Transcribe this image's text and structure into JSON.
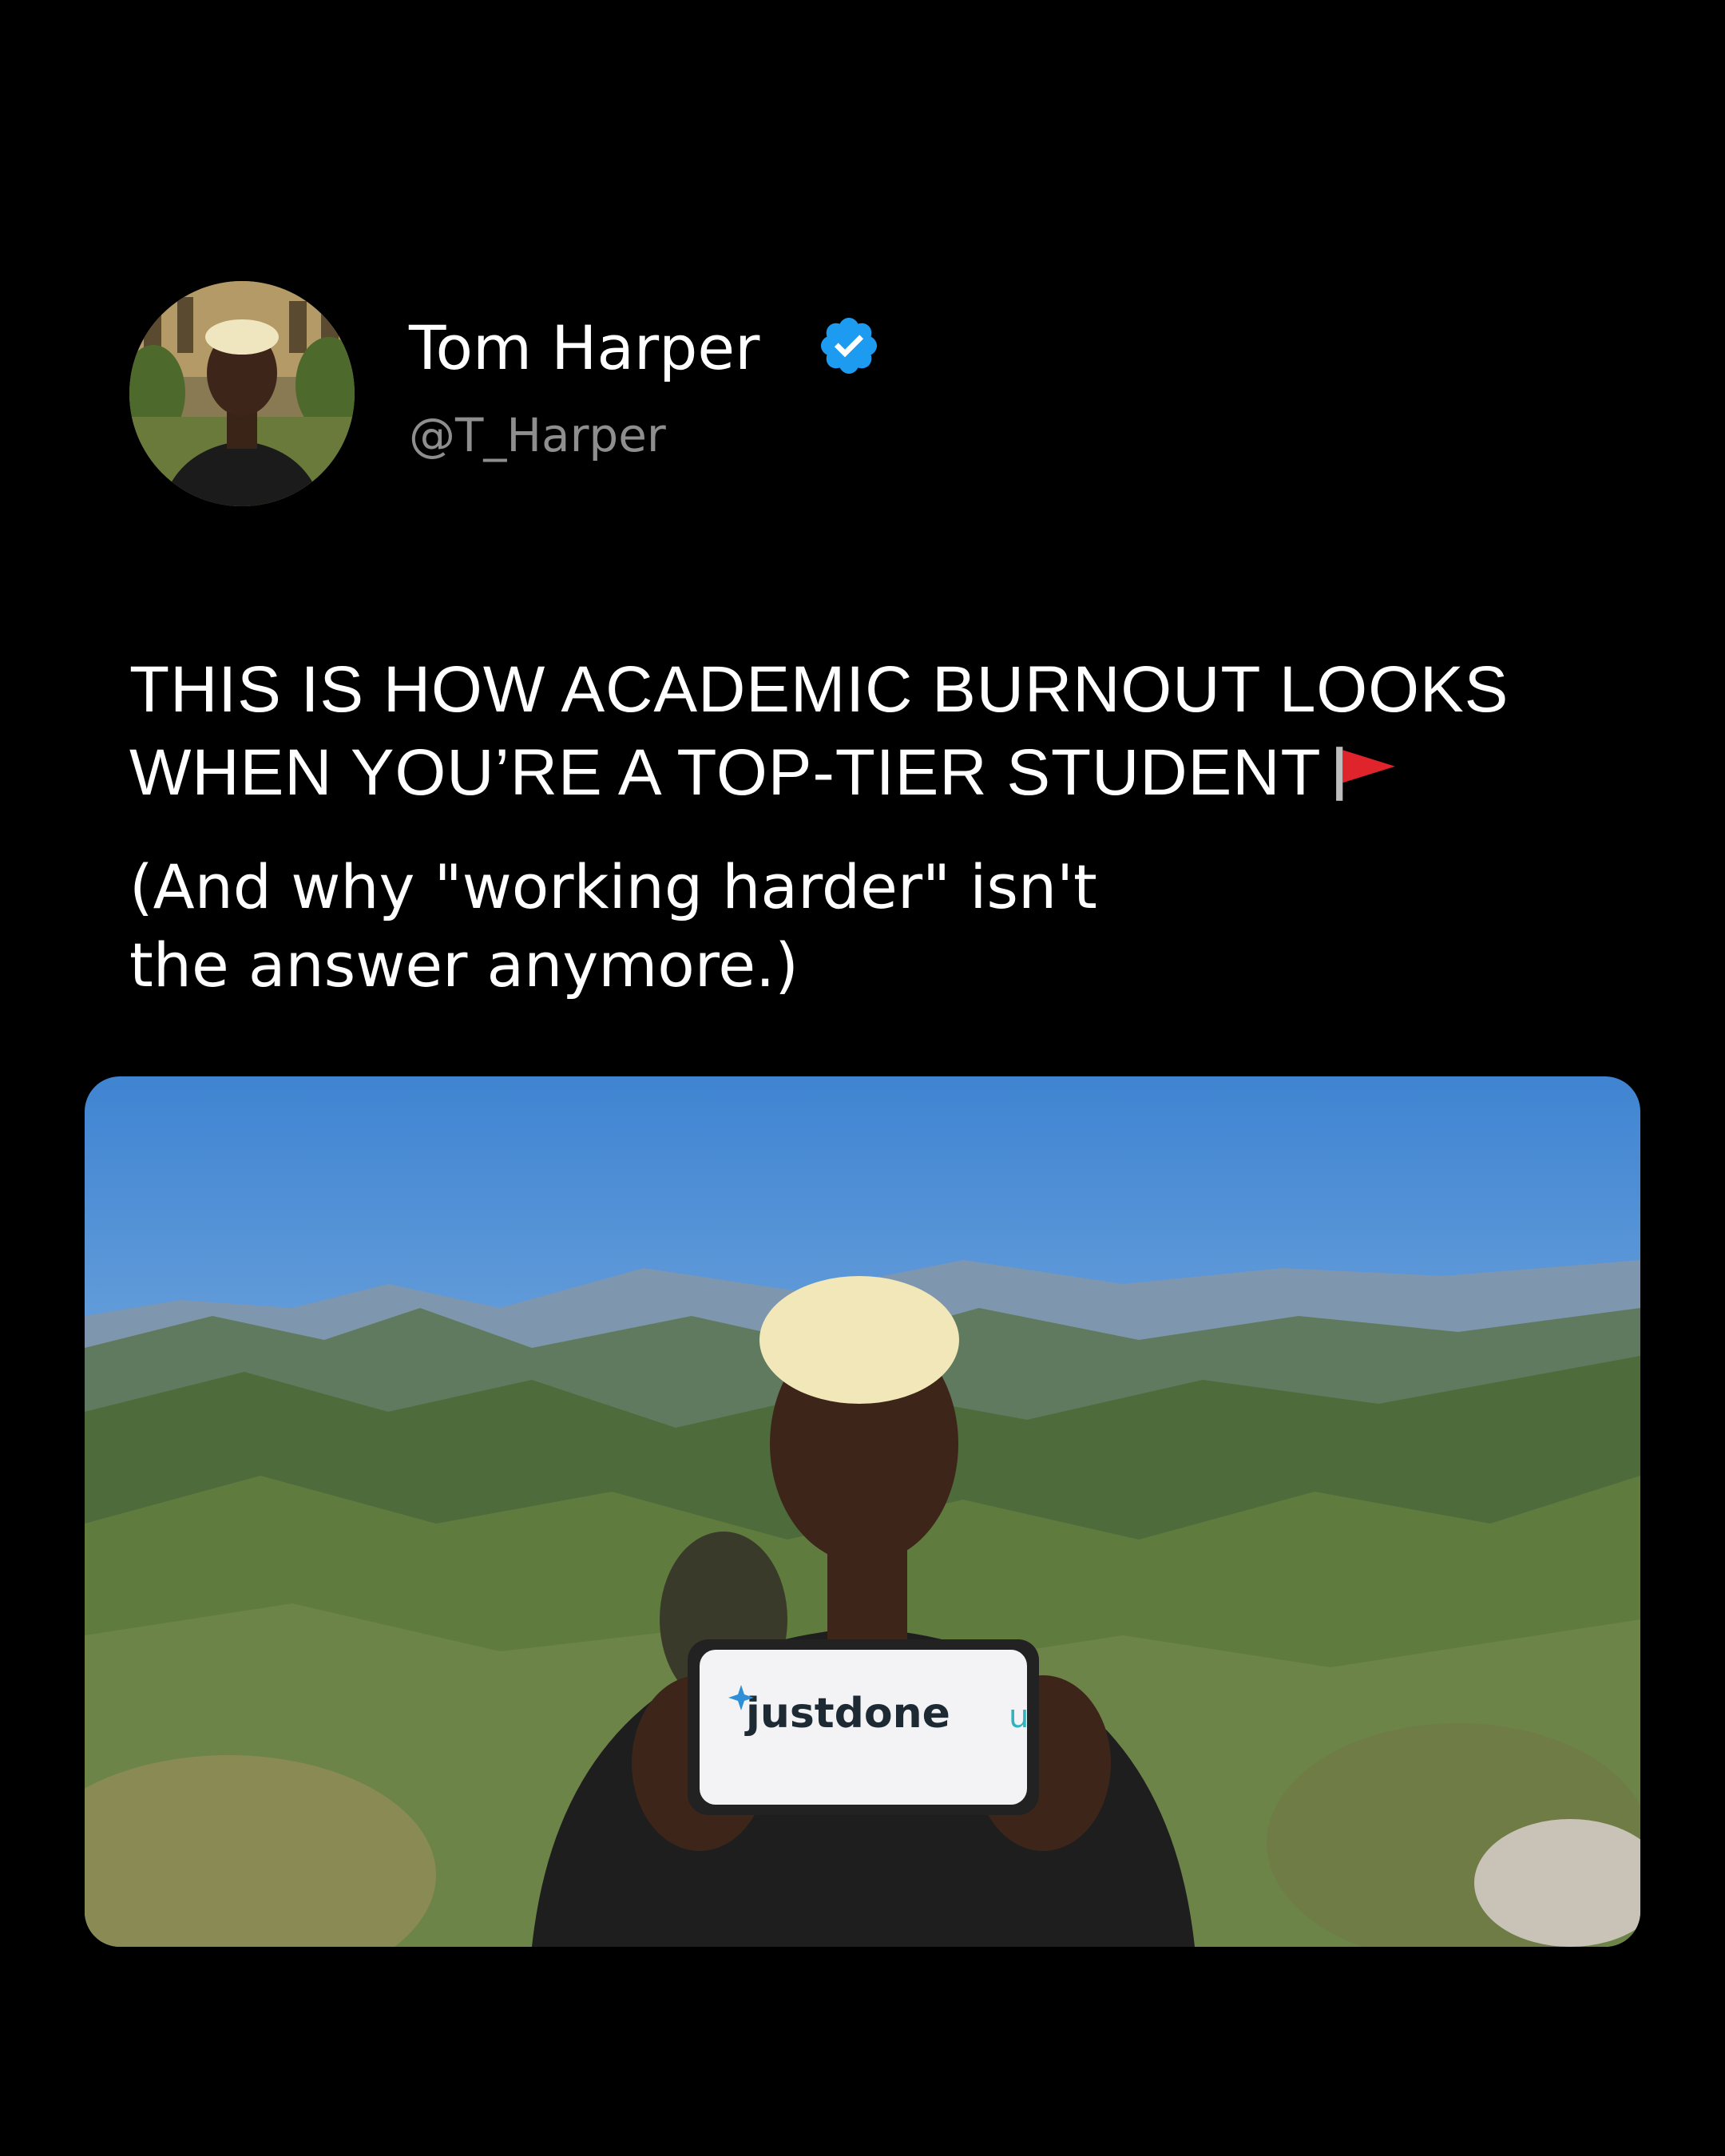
{
  "profile": {
    "name": "Tom Harper",
    "handle": "@T_Harper",
    "verified_icon": "verified-badge-icon",
    "verified_color": "#1d9bf0"
  },
  "post": {
    "headline_line1": "THIS IS HOW ACADEMIC BURNOUT LOOKS",
    "headline_line2": "WHEN YOU’RE A TOP-TIER STUDENT",
    "headline_icon": "red-flag-icon",
    "subtext_line1": "(And why \"working harder\" isn't",
    "subtext_line2": "the answer anymore.)"
  },
  "photo": {
    "phone_screen_text": "justdone",
    "phone_partial_text": "u"
  },
  "colors": {
    "background": "#000000",
    "text": "#ffffff",
    "handle": "#8e8e8e",
    "flag": "#e0242b"
  }
}
